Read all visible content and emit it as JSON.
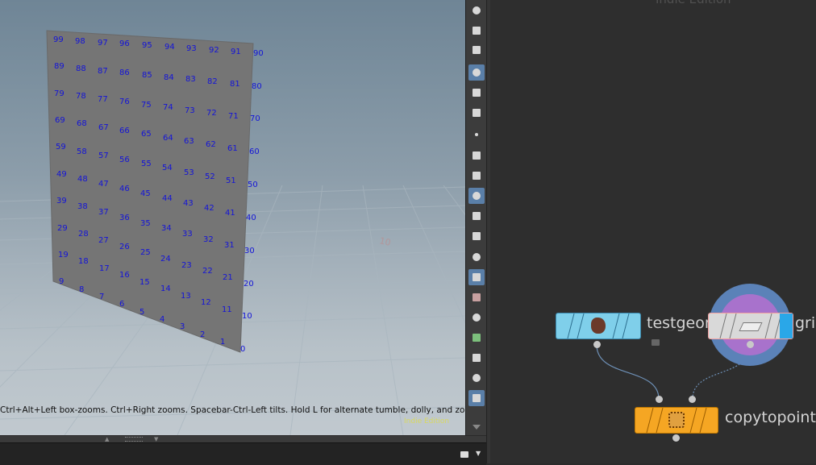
{
  "viewport": {
    "hint_text": "Ctrl+Alt+Left box-zooms. Ctrl+Right zooms. Spacebar-Ctrl-Left tilts. Hold L for alternate tumble, dolly, and zoom.",
    "watermark": "Indie Edition",
    "floor_label": "10",
    "point_numbers": [
      "0",
      "1",
      "2",
      "3",
      "4",
      "5",
      "6",
      "7",
      "8",
      "9",
      "10",
      "11",
      "12",
      "13",
      "14",
      "15",
      "16",
      "17",
      "18",
      "19",
      "20",
      "21",
      "22",
      "23",
      "24",
      "25",
      "26",
      "27",
      "28",
      "29",
      "30",
      "31",
      "32",
      "33",
      "34",
      "35",
      "36",
      "37",
      "38",
      "39",
      "40",
      "41",
      "42",
      "43",
      "44",
      "45",
      "46",
      "47",
      "48",
      "49",
      "50",
      "51",
      "52",
      "53",
      "54",
      "55",
      "56",
      "57",
      "58",
      "59",
      "60",
      "61",
      "62",
      "63",
      "64",
      "65",
      "66",
      "67",
      "68",
      "69",
      "70",
      "71",
      "72",
      "73",
      "74",
      "75",
      "76",
      "77",
      "78",
      "79",
      "80",
      "81",
      "82",
      "83",
      "84",
      "85",
      "86",
      "87",
      "88",
      "89",
      "90",
      "91",
      "92",
      "93",
      "94",
      "95",
      "96",
      "97",
      "98",
      "99"
    ]
  },
  "toolbar": {
    "icons": [
      "lamp-icon",
      "camera-light-icon",
      "camera-reset-icon",
      "home-view-icon",
      "snap-icon",
      "snap-options-icon",
      "point-display-icon",
      "normal-display-icon",
      "vector-display-icon",
      "point-number-icon",
      "brush-icon",
      "prim-number-icon",
      "axis-icon",
      "smooth-shading-icon",
      "texture-icon",
      "ghost-icon",
      "group-icon",
      "handle-icon",
      "background-icon",
      "image-icon",
      "down-arrow-icon"
    ]
  },
  "network": {
    "watermark": "Indie Edition",
    "nodes": [
      {
        "label": "testgeometry",
        "color": "#7fcfea"
      },
      {
        "label": "grid",
        "color": "#d9d9d9"
      },
      {
        "label": "copytopoints",
        "color": "#f5a623"
      }
    ]
  }
}
